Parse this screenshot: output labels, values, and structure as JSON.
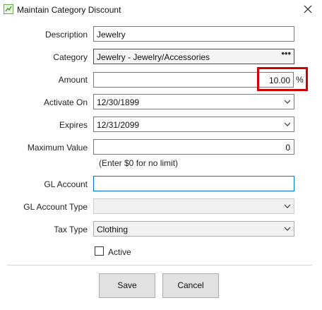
{
  "window": {
    "title": "Maintain Category Discount",
    "app_icon": "green-app-icon",
    "close_icon": "close-icon"
  },
  "form": {
    "description": {
      "label": "Description",
      "value": "Jewelry"
    },
    "category": {
      "label": "Category",
      "value": "Jewelry - Jewelry/Accessories",
      "button": "•••"
    },
    "amount": {
      "label": "Amount",
      "value": "10.00",
      "unit": "%"
    },
    "activate_on": {
      "label": "Activate On",
      "value": "12/30/1899"
    },
    "expires": {
      "label": "Expires",
      "value": "12/31/2099"
    },
    "maximum_value": {
      "label": "Maximum Value",
      "value": "0",
      "hint": "(Enter $0 for no limit)"
    },
    "gl_account": {
      "label": "GL Account",
      "value": ""
    },
    "gl_account_type": {
      "label": "GL Account Type",
      "value": ""
    },
    "tax_type": {
      "label": "Tax Type",
      "value": "Clothing"
    },
    "active": {
      "label": "Active",
      "checked": false
    }
  },
  "buttons": {
    "save": "Save",
    "cancel": "Cancel"
  },
  "colors": {
    "highlight": "#d00000",
    "focus_border": "#0078d7"
  }
}
